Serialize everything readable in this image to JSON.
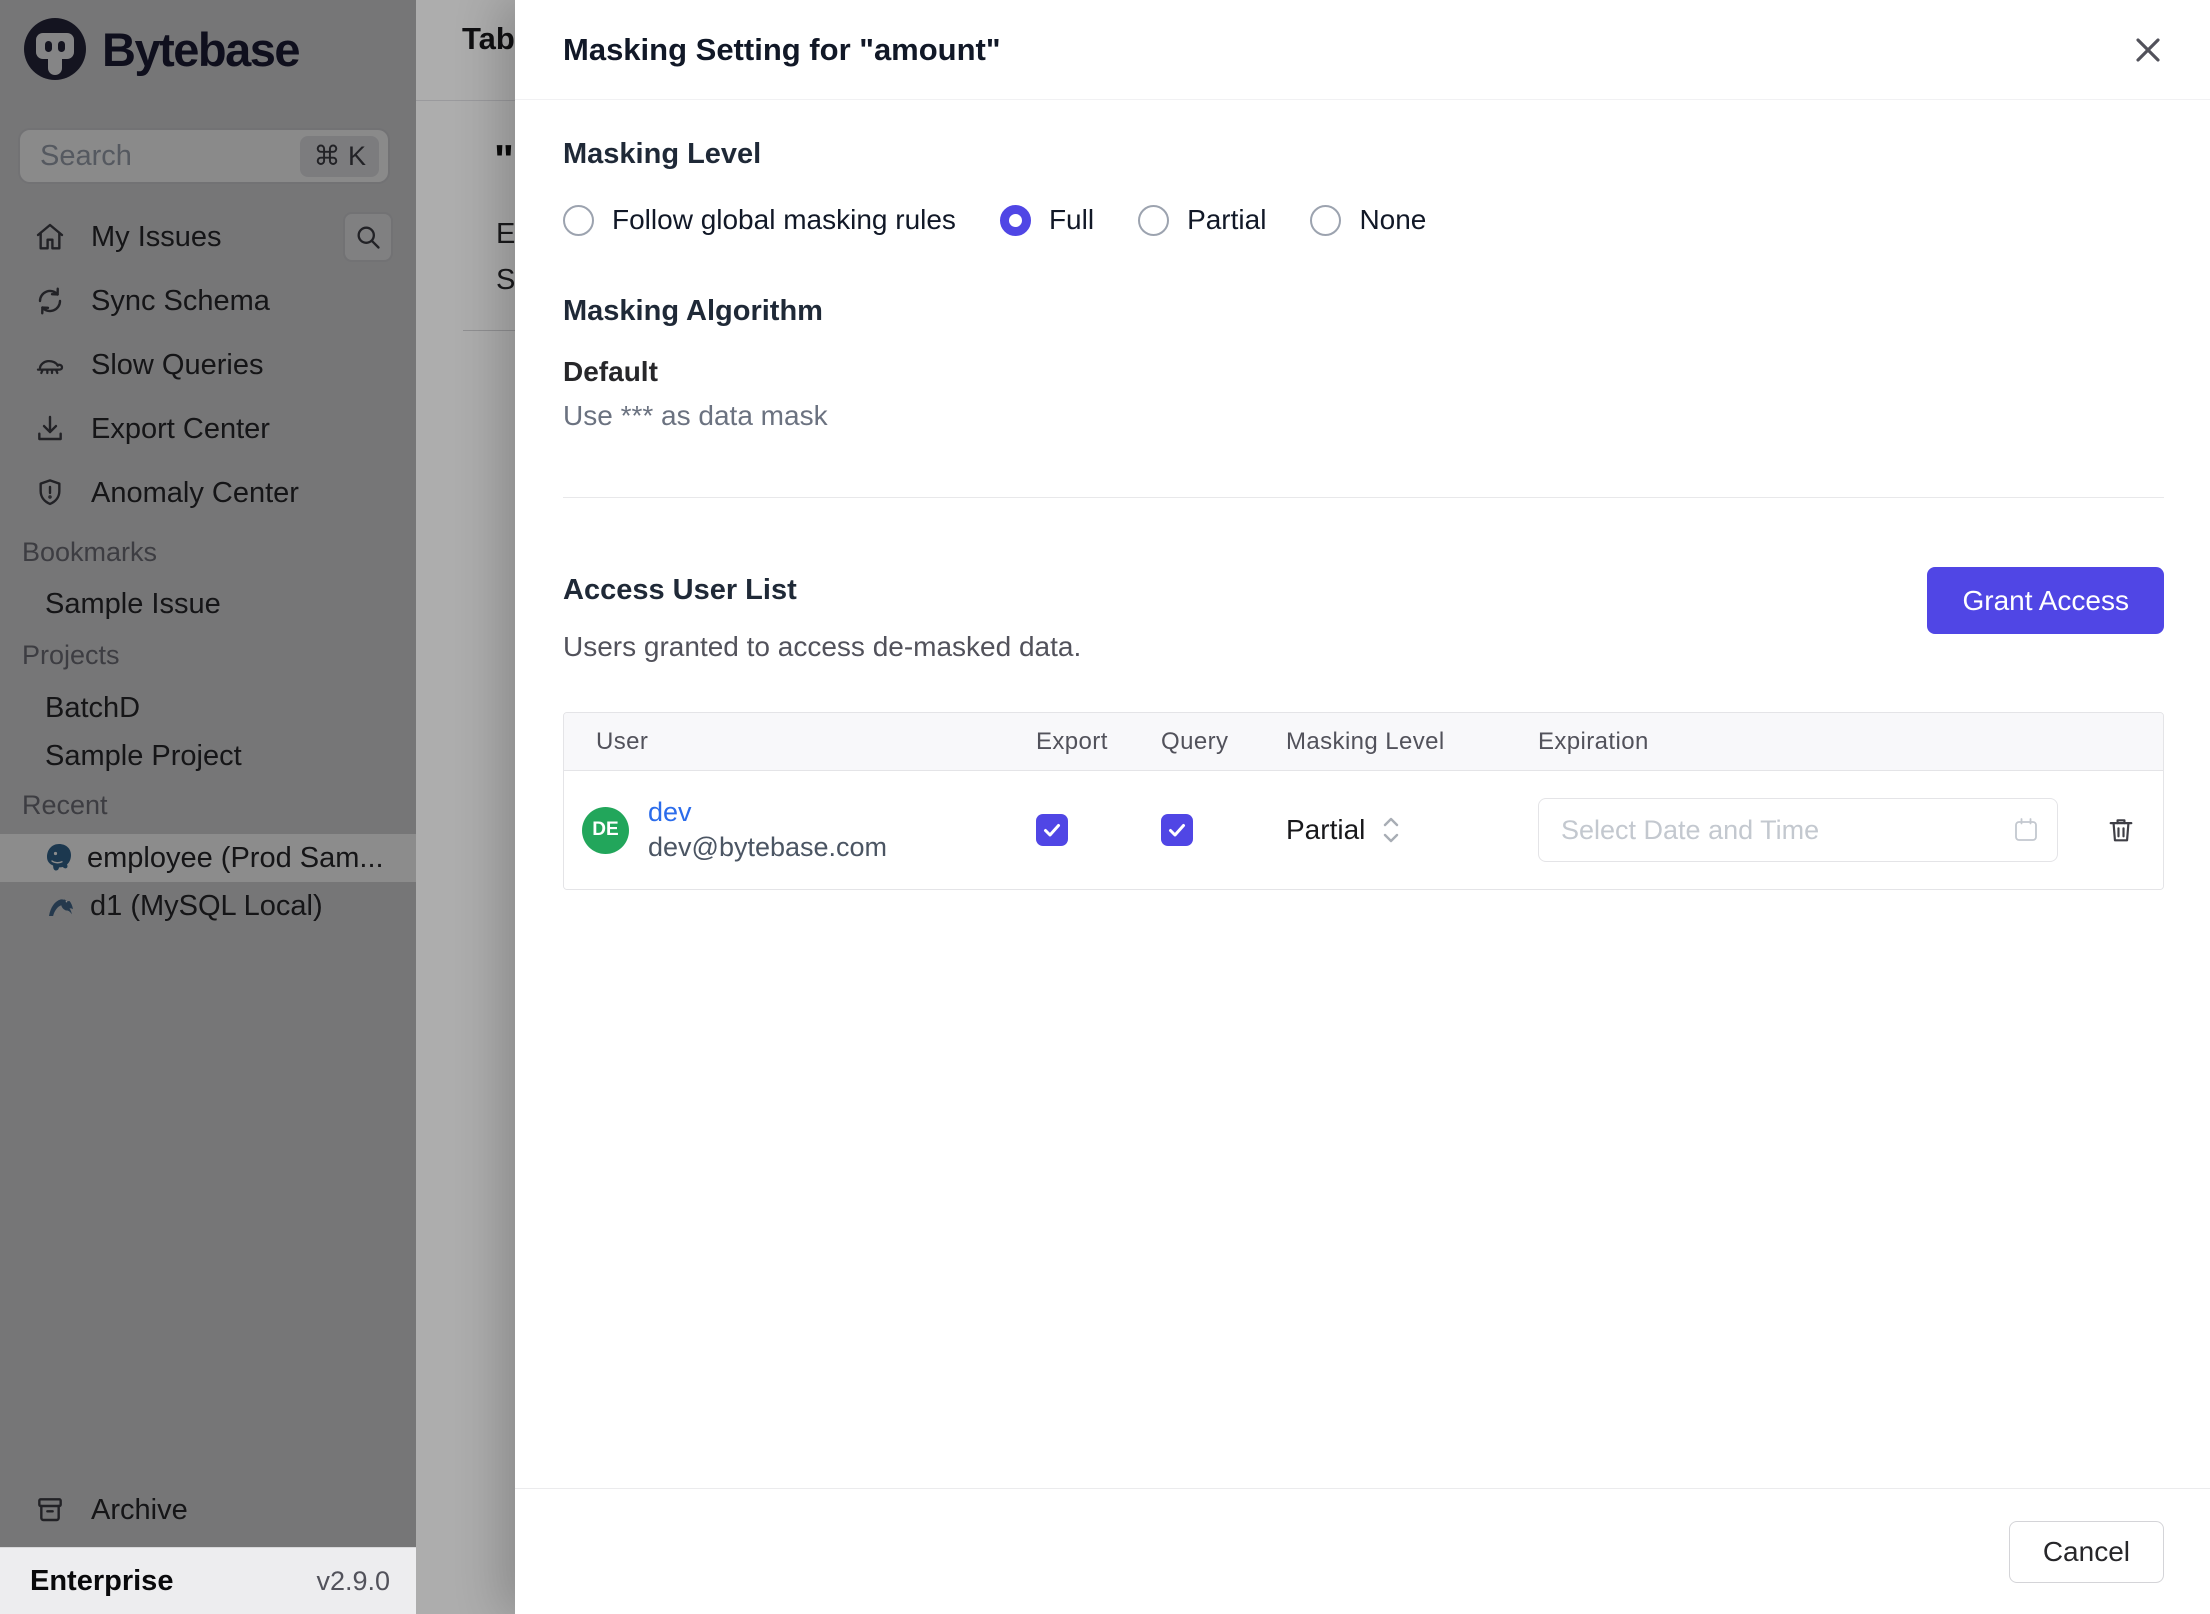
{
  "app": {
    "name": "Bytebase",
    "plan": "Enterprise",
    "version": "v2.9.0"
  },
  "colors": {
    "accent": "#5046e5",
    "avatar_green": "#22a65b",
    "link_blue": "#2b6ceb",
    "postgres_blue": "#336791",
    "mysql_blue": "#44698c"
  },
  "sidebar": {
    "search": {
      "placeholder": "Search",
      "shortcut": "⌘ K"
    },
    "nav": [
      {
        "label": "My Issues",
        "icon": "home-icon"
      },
      {
        "label": "Sync Schema",
        "icon": "sync-icon"
      },
      {
        "label": "Slow Queries",
        "icon": "turtle-icon"
      },
      {
        "label": "Export Center",
        "icon": "download-icon"
      },
      {
        "label": "Anomaly Center",
        "icon": "shield-icon"
      }
    ],
    "sections": [
      {
        "title": "Bookmarks",
        "items": [
          {
            "label": "Sample Issue"
          }
        ]
      },
      {
        "title": "Projects",
        "items": [
          {
            "label": "BatchD"
          },
          {
            "label": "Sample Project"
          }
        ]
      },
      {
        "title": "Recent",
        "items": [
          {
            "label": "employee (Prod Sam...",
            "icon": "postgres-icon",
            "selected": true
          },
          {
            "label": "d1 (MySQL Local)",
            "icon": "mysql-icon",
            "selected": false
          }
        ]
      }
    ],
    "archive_label": "Archive"
  },
  "background_page": {
    "title_fragment": "Tab",
    "quote_mark": "\"",
    "line1": "E",
    "line2": "S"
  },
  "modal": {
    "title": "Masking Setting for \"amount\"",
    "masking_level": {
      "heading": "Masking Level",
      "options": [
        {
          "label": "Follow global masking rules",
          "selected": false
        },
        {
          "label": "Full",
          "selected": true
        },
        {
          "label": "Partial",
          "selected": false
        },
        {
          "label": "None",
          "selected": false
        }
      ]
    },
    "masking_algorithm": {
      "heading": "Masking Algorithm",
      "name": "Default",
      "description": "Use *** as data mask"
    },
    "access_user_list": {
      "heading": "Access User List",
      "subtitle": "Users granted to access de-masked data.",
      "grant_button": "Grant Access",
      "table": {
        "columns": [
          "User",
          "Export",
          "Query",
          "Masking Level",
          "Expiration"
        ],
        "rows": [
          {
            "avatar_initials": "DE",
            "name": "dev",
            "email": "dev@bytebase.com",
            "export_checked": true,
            "query_checked": true,
            "masking_level": "Partial",
            "expiration_placeholder": "Select Date and Time"
          }
        ]
      }
    },
    "footer": {
      "cancel_label": "Cancel"
    }
  }
}
